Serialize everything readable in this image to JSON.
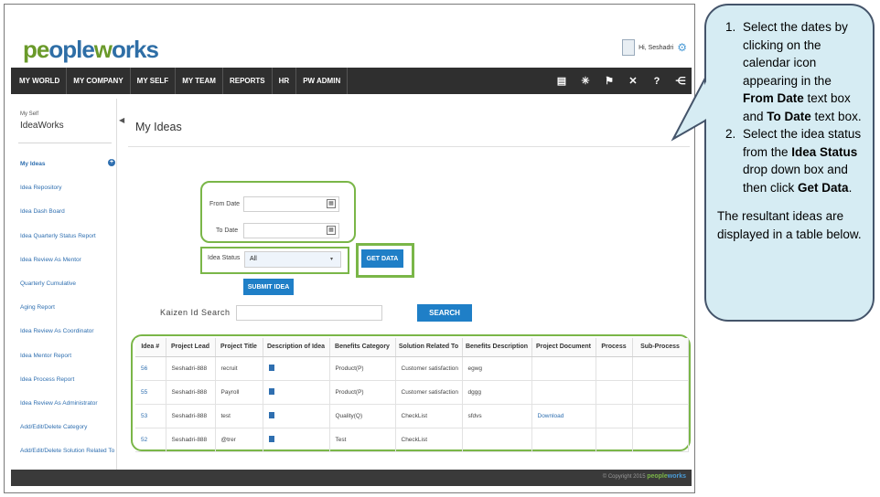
{
  "header": {
    "logo_part1": "pe",
    "logo_part2": "ople",
    "logo_part3": "w",
    "logo_part4": "orks",
    "user_greeting": "Hi, Seshadri"
  },
  "nav": {
    "items": [
      "MY WORLD",
      "MY COMPANY",
      "MY SELF",
      "MY TEAM",
      "REPORTS",
      "HR",
      "PW ADMIN"
    ],
    "icons": [
      "book-icon",
      "bulb-icon",
      "flag-icon",
      "tools-icon",
      "help-icon",
      "share-icon"
    ]
  },
  "sidebar": {
    "crumb": "My Self",
    "title": "IdeaWorks",
    "items": [
      "My Ideas",
      "Idea Repository",
      "Idea Dash Board",
      "Idea Quarterly Status Report",
      "Idea Review As Mentor",
      "Quarterly Cumulative",
      "Aging Report",
      "Idea Review As Coordinator",
      "Idea Mentor Report",
      "Idea Process Report",
      "Idea Review As Administrator",
      "Add/Edit/Delete Category",
      "Add/Edit/Delete Solution Related To"
    ]
  },
  "main": {
    "title": "My Ideas",
    "from_date_label": "From Date",
    "to_date_label": "To Date",
    "idea_status_label": "Idea Status",
    "idea_status_value": "All",
    "get_data_label": "GET DATA",
    "submit_idea_label": "SUBMIT IDEA",
    "kaizen_label": "Kaizen Id Search",
    "search_label": "SEARCH"
  },
  "table": {
    "headers": [
      "Idea #",
      "Project Lead",
      "Project Title",
      "Description of Idea",
      "Benefits Category",
      "Solution Related To",
      "Benefits Description",
      "Project Document",
      "Process",
      "Sub-Process"
    ],
    "rows": [
      [
        "56",
        "Seshadri-888",
        "recruit",
        "",
        "Product(P)",
        "Customer satisfaction",
        "egwg",
        "",
        "",
        ""
      ],
      [
        "55",
        "Seshadri-888",
        "Payroll",
        "",
        "Product(P)",
        "Customer satisfaction",
        "dggg",
        "",
        "",
        ""
      ],
      [
        "53",
        "Seshadri-888",
        "test",
        "",
        "Quality(Q)",
        "CheckList",
        "sfdvs",
        "Download",
        "",
        ""
      ],
      [
        "52",
        "Seshadri-888",
        "@trer",
        "",
        "Test",
        "CheckList",
        "",
        "",
        "",
        ""
      ]
    ]
  },
  "footer": {
    "copyright": "© Copyright 2015",
    "brand_a": "people",
    "brand_b": "works"
  },
  "callout": {
    "step1_a": "Select the dates by clicking on the calendar icon appearing in the ",
    "step1_b": "From Date",
    "step1_c": " text box and ",
    "step1_d": "To Date",
    "step1_e": " text box.",
    "step2_a": "Select the idea status from the ",
    "step2_b": "Idea Status",
    "step2_c": " drop down box and then click ",
    "step2_d": "Get Data",
    "step2_e": ".",
    "result": "The resultant ideas are displayed in a table below."
  },
  "colors": {
    "nav_bg": "#2f2f2f",
    "button_blue": "#1f7fc7",
    "highlight_green": "#7ab648",
    "callout_bg": "#d6ecf3",
    "link_blue": "#2f6fb0"
  }
}
